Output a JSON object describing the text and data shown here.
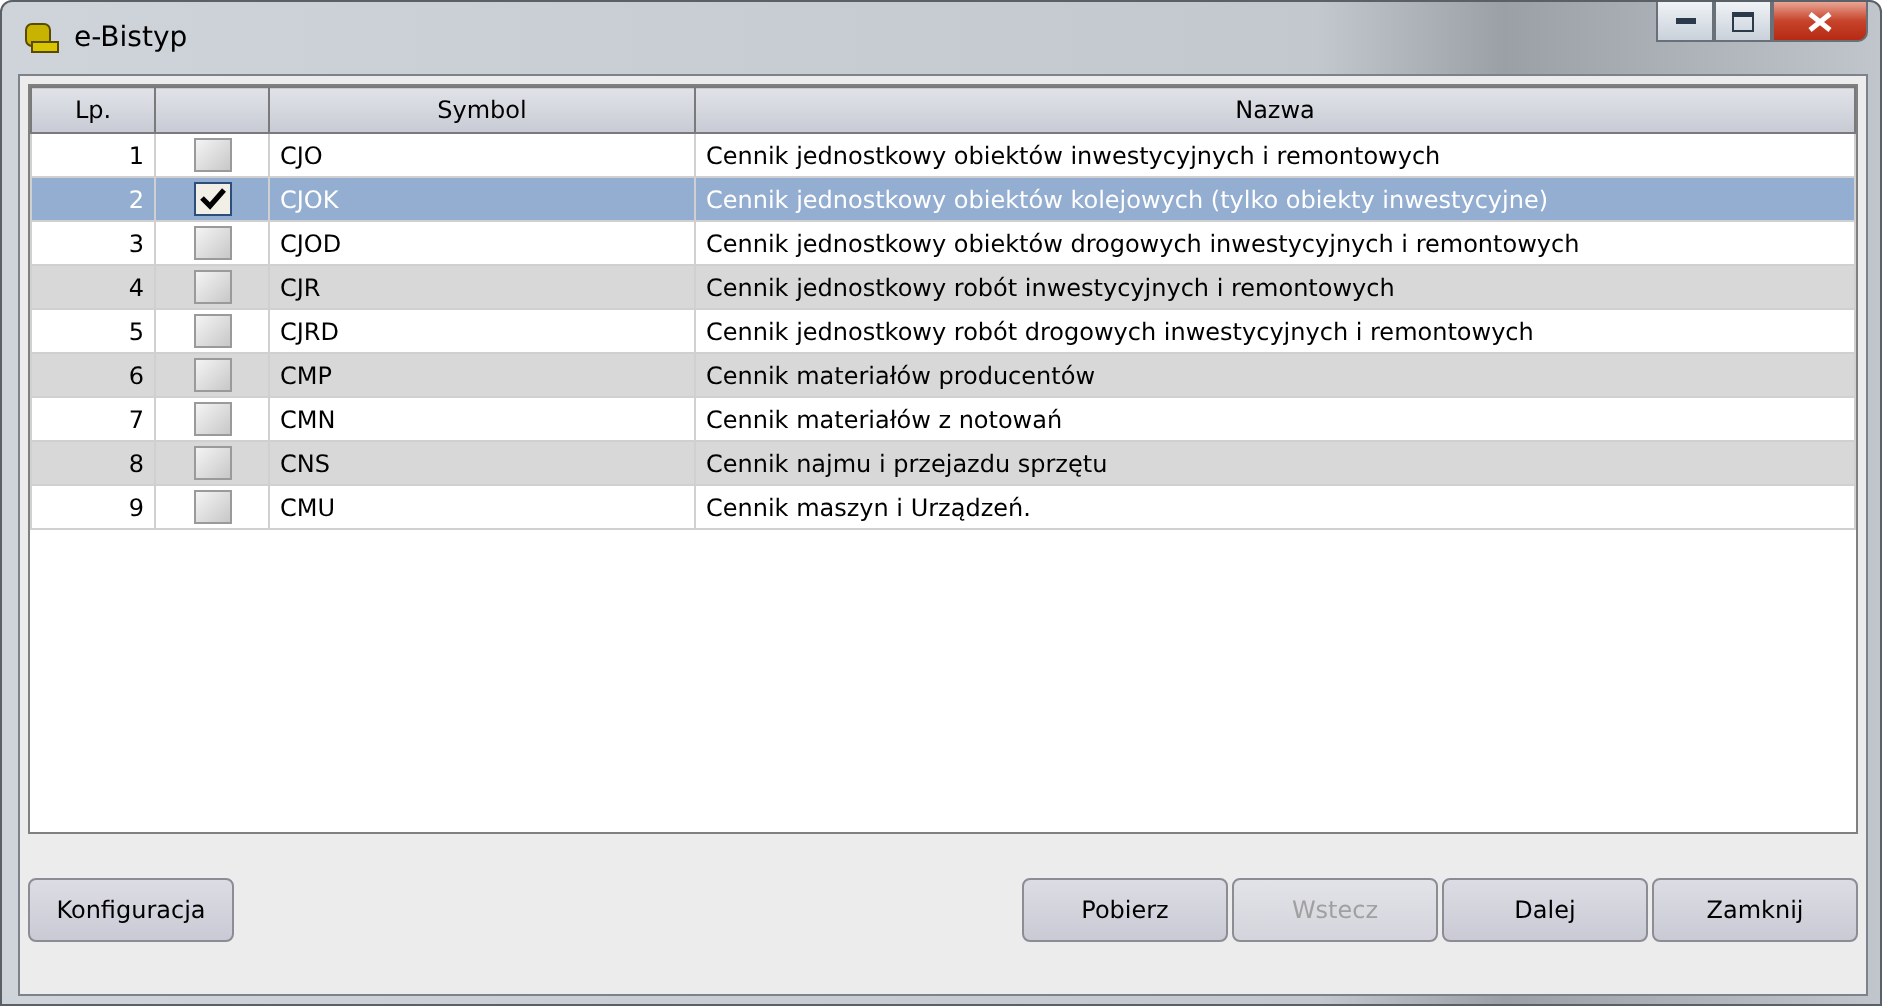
{
  "window": {
    "title": "e-Bistyp"
  },
  "table": {
    "columns": [
      "Lp.",
      "",
      "Symbol",
      "Nazwa"
    ],
    "rows": [
      {
        "lp": "1",
        "checked": false,
        "selected": false,
        "symbol": "CJO",
        "name": "Cennik jednostkowy obiektów inwestycyjnych i remontowych"
      },
      {
        "lp": "2",
        "checked": true,
        "selected": true,
        "symbol": "CJOK",
        "name": "Cennik jednostkowy obiektów kolejowych (tylko obiekty inwestycyjne)"
      },
      {
        "lp": "3",
        "checked": false,
        "selected": false,
        "symbol": "CJOD",
        "name": "Cennik jednostkowy obiektów drogowych inwestycyjnych i remontowych"
      },
      {
        "lp": "4",
        "checked": false,
        "selected": false,
        "symbol": "CJR",
        "name": "Cennik jednostkowy robót inwestycyjnych i remontowych"
      },
      {
        "lp": "5",
        "checked": false,
        "selected": false,
        "symbol": "CJRD",
        "name": "Cennik jednostkowy robót drogowych inwestycyjnych i remontowych"
      },
      {
        "lp": "6",
        "checked": false,
        "selected": false,
        "symbol": "CMP",
        "name": "Cennik materiałów producentów"
      },
      {
        "lp": "7",
        "checked": false,
        "selected": false,
        "symbol": "CMN",
        "name": "Cennik materiałów z notowań"
      },
      {
        "lp": "8",
        "checked": false,
        "selected": false,
        "symbol": "CNS",
        "name": "Cennik najmu i przejazdu sprzętu"
      },
      {
        "lp": "9",
        "checked": false,
        "selected": false,
        "symbol": "CMU",
        "name": "Cennik maszyn i Urządzeń."
      }
    ]
  },
  "buttons_left": [
    {
      "label": "Konfiguracja",
      "disabled": false
    }
  ],
  "buttons_right": [
    {
      "label": "Pobierz",
      "disabled": false
    },
    {
      "label": "Wstecz",
      "disabled": true
    },
    {
      "label": "Dalej",
      "disabled": false
    },
    {
      "label": "Zamknij",
      "disabled": false
    }
  ]
}
